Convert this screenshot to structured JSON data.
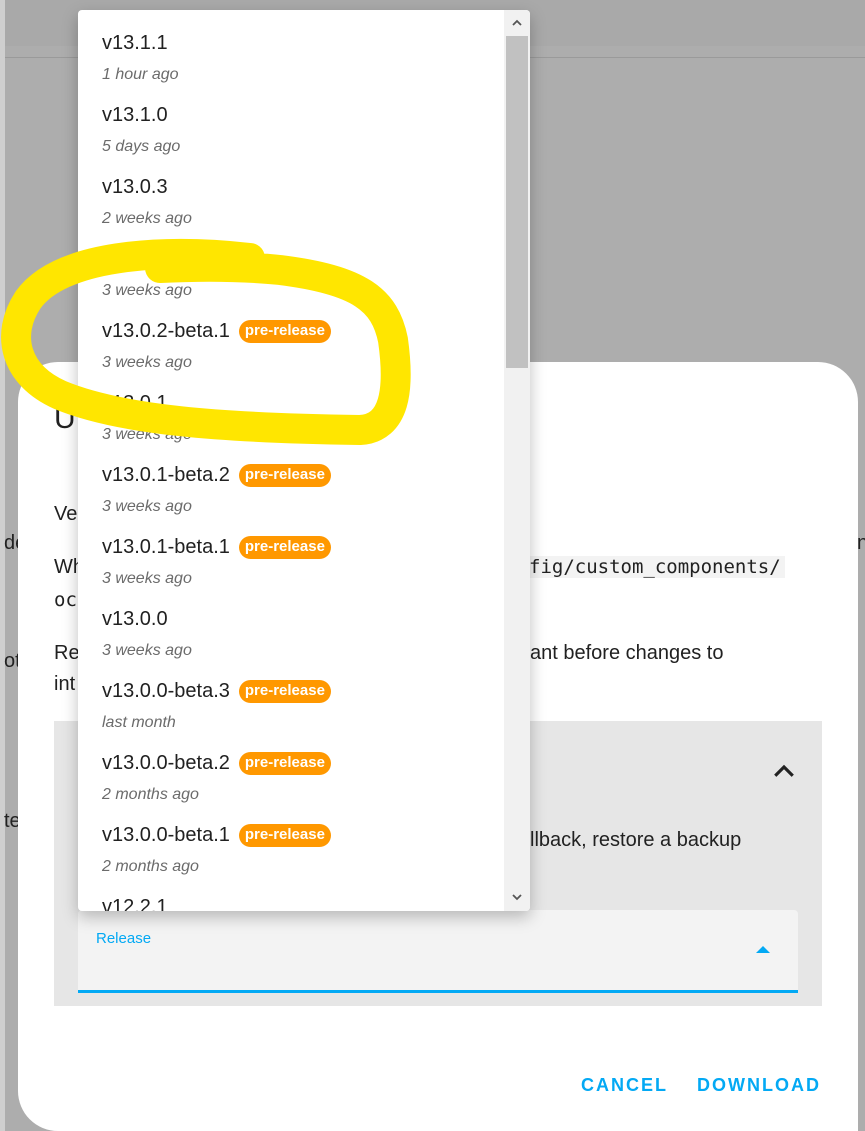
{
  "background": {
    "fragments": [
      "de",
      "ot",
      "te",
      "n"
    ]
  },
  "dialog": {
    "title_fragment": "U",
    "version_fragment": "Ve",
    "when_fragment": "Wh",
    "path_fragment_right": "fig/custom_components/",
    "path_fragment_left": "oc",
    "restart_fragment_left": "Re",
    "restart_fragment_right": "ant before changes to",
    "int_fragment": "int",
    "rollback_fragment": "llback, restore a backup",
    "release_label": "Release",
    "cancel_label": "CANCEL",
    "download_label": "DOWNLOAD"
  },
  "dropdown": {
    "items": [
      {
        "version": "v13.1.1",
        "time": "1 hour ago",
        "badge": ""
      },
      {
        "version": "v13.1.0",
        "time": "5 days ago",
        "badge": ""
      },
      {
        "version": "v13.0.3",
        "time": "2 weeks ago",
        "badge": ""
      },
      {
        "version": "v13.0.2",
        "time": "3 weeks ago",
        "badge": ""
      },
      {
        "version": "v13.0.2-beta.1",
        "time": "3 weeks ago",
        "badge": "pre-release"
      },
      {
        "version": "v13.0.1",
        "time": "3 weeks ago",
        "badge": ""
      },
      {
        "version": "v13.0.1-beta.2",
        "time": "3 weeks ago",
        "badge": "pre-release"
      },
      {
        "version": "v13.0.1-beta.1",
        "time": "3 weeks ago",
        "badge": "pre-release"
      },
      {
        "version": "v13.0.0",
        "time": "3 weeks ago",
        "badge": ""
      },
      {
        "version": "v13.0.0-beta.3",
        "time": "last month",
        "badge": "pre-release"
      },
      {
        "version": "v13.0.0-beta.2",
        "time": "2 months ago",
        "badge": "pre-release"
      },
      {
        "version": "v13.0.0-beta.1",
        "time": "2 months ago",
        "badge": "pre-release"
      },
      {
        "version": "v12.2.1",
        "time": "",
        "badge": ""
      }
    ]
  },
  "colors": {
    "accent": "#03a9f4",
    "badge": "#ff9800",
    "highlight": "#ffe600"
  }
}
